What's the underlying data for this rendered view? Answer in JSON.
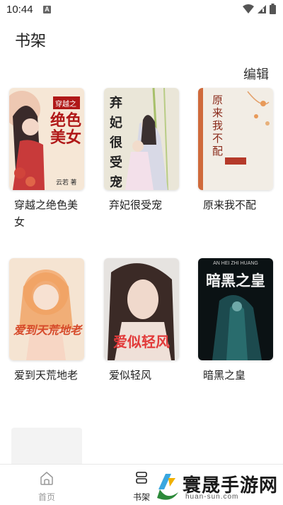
{
  "status_bar": {
    "time": "10:44",
    "notification_badge": "A"
  },
  "header": {
    "title": "书架",
    "edit_label": "编辑"
  },
  "books": [
    {
      "title": "穿越之绝色美女",
      "cover_text": "绝色美女",
      "cover_sub": "穿越之",
      "cover_author": "云若 著"
    },
    {
      "title": "弃妃很受宠",
      "cover_text": "弃妃很受宠"
    },
    {
      "title": "原来我不配",
      "cover_text": "原来我不配"
    },
    {
      "title": "爱到天荒地老",
      "cover_text": "爱到天荒地老"
    },
    {
      "title": "爱似轻风",
      "cover_text": "爱似轻风"
    },
    {
      "title": "暗黑之皇",
      "cover_text": "暗黑之皇",
      "cover_sub": "AN HEI ZHI HUANG"
    }
  ],
  "bottom_nav": {
    "home_label": "首页",
    "shelf_label": "书架"
  },
  "watermark": {
    "text": "寰晟手游网",
    "url": "huan-sun.com"
  },
  "colors": {
    "accent": "#222222",
    "nav_inactive": "#999999"
  }
}
